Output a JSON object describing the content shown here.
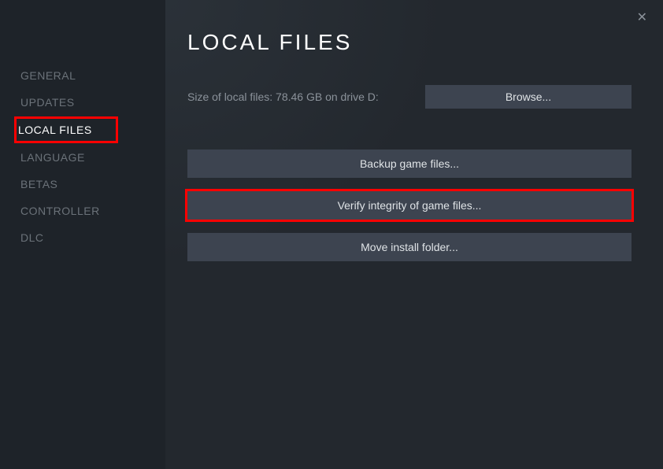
{
  "sidebar": {
    "items": [
      {
        "label": "GENERAL",
        "active": false,
        "highlighted": false
      },
      {
        "label": "UPDATES",
        "active": false,
        "highlighted": false
      },
      {
        "label": "LOCAL FILES",
        "active": true,
        "highlighted": true
      },
      {
        "label": "LANGUAGE",
        "active": false,
        "highlighted": false
      },
      {
        "label": "BETAS",
        "active": false,
        "highlighted": false
      },
      {
        "label": "CONTROLLER",
        "active": false,
        "highlighted": false
      },
      {
        "label": "DLC",
        "active": false,
        "highlighted": false
      }
    ]
  },
  "main": {
    "title": "LOCAL FILES",
    "size_text": "Size of local files: 78.46 GB on drive D:",
    "browse_label": "Browse...",
    "backup_label": "Backup game files...",
    "verify_label": "Verify integrity of game files...",
    "move_label": "Move install folder..."
  }
}
